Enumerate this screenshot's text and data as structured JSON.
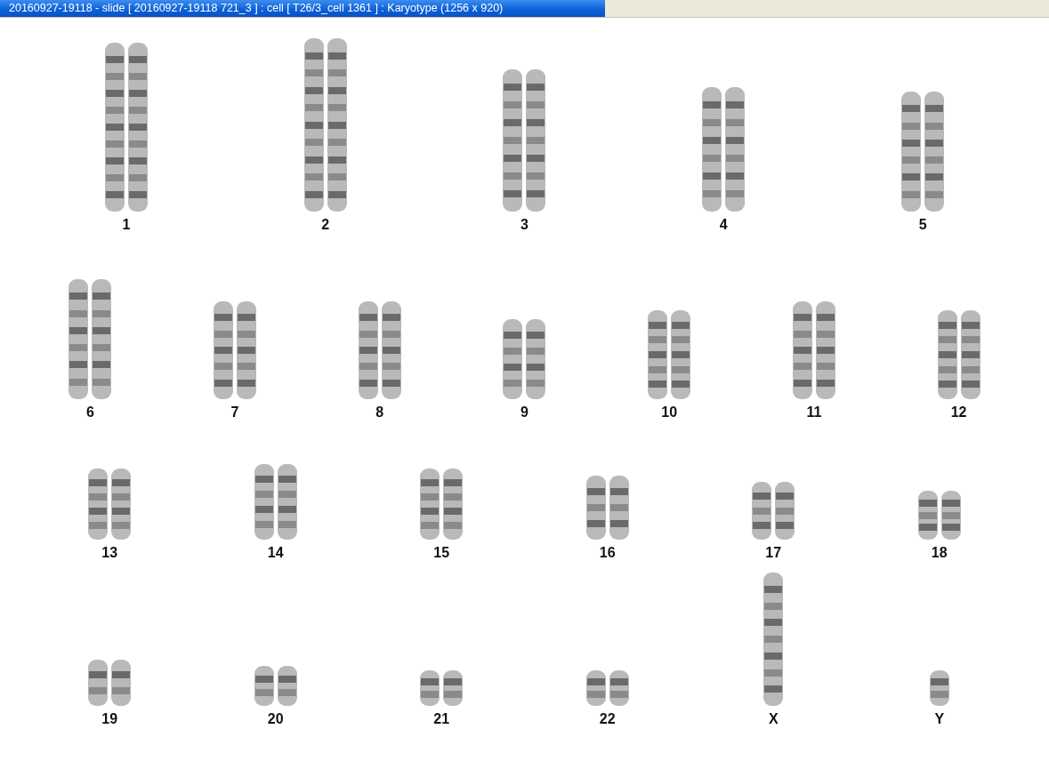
{
  "window": {
    "title": "20160927-19118 - slide [ 20160927-19118 721_3 ] : cell [ T26/3_cell 1361 ] : Karyotype  (1256 x 920)"
  },
  "karyotype": {
    "rows": [
      {
        "items": [
          {
            "label": "1",
            "kind": "pair"
          },
          {
            "label": "2",
            "kind": "pair"
          },
          {
            "label": "3",
            "kind": "pair"
          },
          {
            "label": "4",
            "kind": "pair"
          },
          {
            "label": "5",
            "kind": "pair"
          }
        ]
      },
      {
        "items": [
          {
            "label": "6",
            "kind": "pair"
          },
          {
            "label": "7",
            "kind": "pair"
          },
          {
            "label": "8",
            "kind": "pair"
          },
          {
            "label": "9",
            "kind": "pair"
          },
          {
            "label": "10",
            "kind": "pair"
          },
          {
            "label": "11",
            "kind": "pair"
          },
          {
            "label": "12",
            "kind": "pair"
          }
        ]
      },
      {
        "items": [
          {
            "label": "13",
            "kind": "pair"
          },
          {
            "label": "14",
            "kind": "pair"
          },
          {
            "label": "15",
            "kind": "pair"
          },
          {
            "label": "16",
            "kind": "pair"
          },
          {
            "label": "17",
            "kind": "pair"
          },
          {
            "label": "18",
            "kind": "pair"
          }
        ]
      },
      {
        "items": [
          {
            "label": "19",
            "kind": "pair"
          },
          {
            "label": "20",
            "kind": "pair"
          },
          {
            "label": "21",
            "kind": "pair"
          },
          {
            "label": "22",
            "kind": "pair"
          },
          {
            "label": "X",
            "kind": "single"
          },
          {
            "label": "Y",
            "kind": "single"
          }
        ]
      }
    ]
  }
}
